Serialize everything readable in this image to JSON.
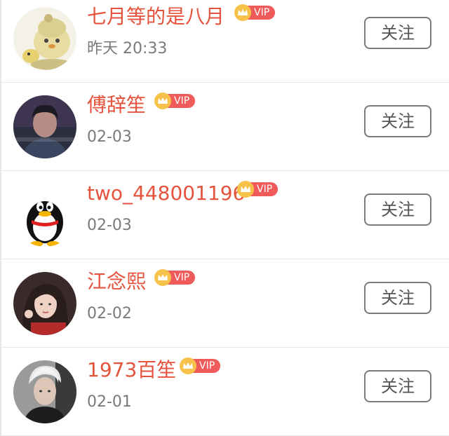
{
  "follow_label": "关注",
  "vip_label": "VIP",
  "colors": {
    "name": "#e5533d",
    "vip_tag": "#ef5a5a",
    "crown": "#f6c24a",
    "time": "#7a7a7a"
  },
  "users": [
    {
      "name": "七月等的是八月",
      "time": "昨天 20:33",
      "avatar": "chick-avatar"
    },
    {
      "name": "傅辞笙",
      "time": "02-03",
      "avatar": "photo-avatar"
    },
    {
      "name": "two_448001196",
      "time": "02-03",
      "avatar": "qq-penguin-avatar"
    },
    {
      "name": "江念熙",
      "time": "02-02",
      "avatar": "photo-avatar"
    },
    {
      "name": "1973百笙",
      "time": "02-01",
      "avatar": "photo-avatar"
    }
  ]
}
